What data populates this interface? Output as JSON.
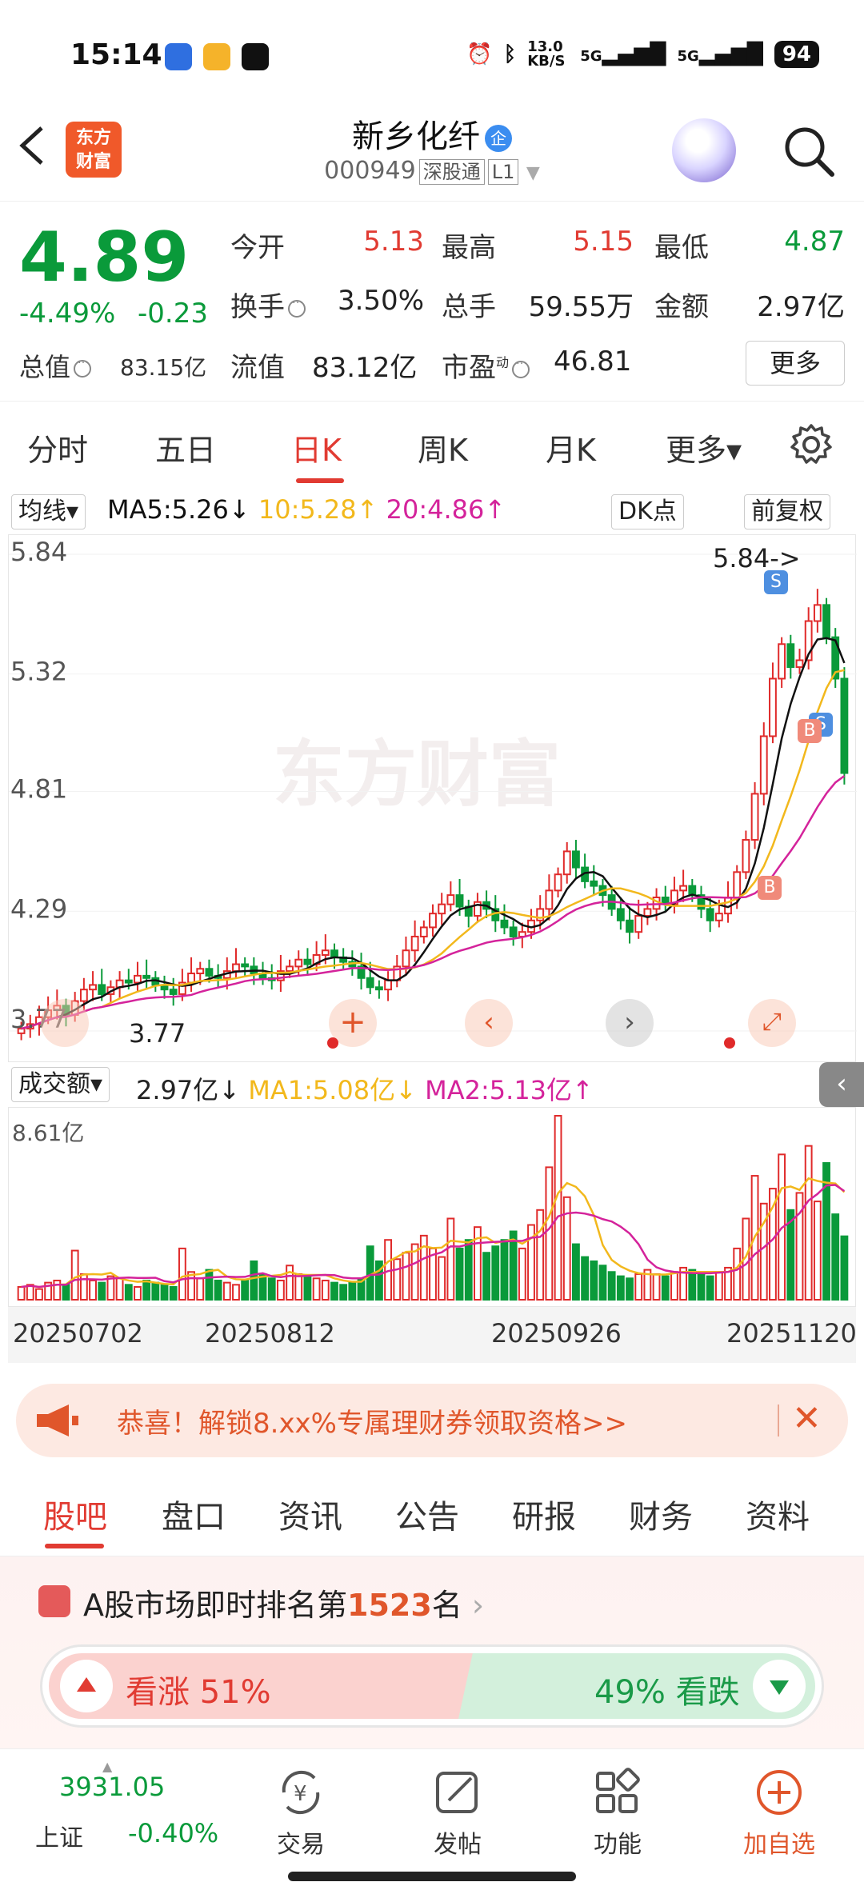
{
  "status_bar": {
    "time": "15:14",
    "net_speed": "13.0 KB/S",
    "network_1": "5G",
    "network_2": "5G",
    "battery": "94"
  },
  "header": {
    "stock_name": "新乡化纤",
    "badge": "企",
    "stock_code": "000949",
    "tag_connect": "深股通",
    "tag_level": "L1",
    "brand_logo": "东方财富"
  },
  "quote": {
    "price": "4.89",
    "pct_change": "-4.49%",
    "abs_change": "-0.23",
    "open_label": "今开",
    "open_value": "5.13",
    "high_label": "最高",
    "high_value": "5.15",
    "low_label": "最低",
    "low_value": "4.87",
    "turnover_label": "换手",
    "turnover_value": "3.50%",
    "volume_label": "总手",
    "volume_value": "59.55万",
    "amount_label": "金额",
    "amount_value": "2.97亿",
    "mktcap_label": "总值",
    "mktcap_value": "83.15亿",
    "float_label": "流值",
    "float_value": "83.12亿",
    "pe_label": "市盈",
    "pe_sup": "动",
    "pe_value": "46.81",
    "more_button": "更多"
  },
  "period_tabs": [
    {
      "label": "分时"
    },
    {
      "label": "五日"
    },
    {
      "label": "日K"
    },
    {
      "label": "周K"
    },
    {
      "label": "月K"
    },
    {
      "label": "更多▾"
    }
  ],
  "ma": {
    "selector": "均线▾",
    "ma5": "MA5:5.26↓",
    "ma10": "10:5.28↑",
    "ma20": "20:4.86↑",
    "dk_button": "DK点",
    "adjust_button": "前复权"
  },
  "kline": {
    "y_labels": [
      "5.84",
      "5.32",
      "4.81",
      "4.29",
      "3.77"
    ],
    "high_marker": "5.84->",
    "low_marker": "3.77",
    "watermark": "东方财富",
    "buy_marker": "B",
    "sell_marker": "S"
  },
  "volume": {
    "selector": "成交额▾",
    "value": "2.97亿↓",
    "ma1": "MA1:5.08亿↓",
    "ma2": "MA2:5.13亿↑",
    "max_label": "8.61亿"
  },
  "dates": [
    "20250702",
    "20250812",
    "20250926",
    "20251120"
  ],
  "promo": {
    "text": "恭喜！解锁8.xx%专属理财券领取资格>>"
  },
  "section_tabs": [
    "股吧",
    "盘口",
    "资讯",
    "公告",
    "研报",
    "财务",
    "资料"
  ],
  "ranking": {
    "prefix": "A股市场即时排名第",
    "number": "1523",
    "suffix": "名",
    "up_text": "看涨 51%",
    "down_text": "49% 看跌"
  },
  "bottom_bar": {
    "index_value": "3931.05",
    "index_name": "上证",
    "index_pct": "-0.40%",
    "nav": [
      "交易",
      "发帖",
      "功能",
      "加自选"
    ]
  },
  "colors": {
    "up": "#e13b32",
    "down": "#0a9a3a",
    "ma5": "#111111",
    "ma10": "#f2b81c",
    "ma20": "#d4239b",
    "brand": "#f0592a"
  },
  "chart_data": [
    {
      "type": "candlestick",
      "title": "日K",
      "x_labels": [
        "20250702",
        "20250812",
        "20250926",
        "20251120"
      ],
      "ylim": [
        3.77,
        5.84
      ],
      "y_ticks": [
        5.84,
        5.32,
        4.81,
        4.29,
        3.77
      ],
      "annotations": [
        {
          "text": "5.84->",
          "value": 5.84
        },
        {
          "text": "3.77",
          "value": 3.77
        }
      ],
      "close_series": [
        3.78,
        3.8,
        3.83,
        3.86,
        3.88,
        3.84,
        3.9,
        3.95,
        3.97,
        3.93,
        3.96,
        3.99,
        3.98,
        4.01,
        4.0,
        3.97,
        3.95,
        3.93,
        3.98,
        4.02,
        4.04,
        4.01,
        4.0,
        4.03,
        4.06,
        4.05,
        4.02,
        4.0,
        3.99,
        4.03,
        4.05,
        4.08,
        4.06,
        4.1,
        4.12,
        4.09,
        4.07,
        4.05,
        4.0,
        3.96,
        3.95,
        3.99,
        4.05,
        4.12,
        4.18,
        4.22,
        4.28,
        4.32,
        4.36,
        4.31,
        4.27,
        4.33,
        4.3,
        4.25,
        4.22,
        4.18,
        4.2,
        4.25,
        4.3,
        4.38,
        4.45,
        4.55,
        4.48,
        4.42,
        4.4,
        4.36,
        4.3,
        4.25,
        4.2,
        4.27,
        4.3,
        4.35,
        4.32,
        4.38,
        4.4,
        4.36,
        4.3,
        4.25,
        4.28,
        4.35,
        4.46,
        4.6,
        4.8,
        5.05,
        5.3,
        5.45,
        5.35,
        5.38,
        5.55,
        5.62,
        5.48,
        5.3,
        4.89
      ],
      "series": [
        {
          "name": "MA5",
          "value": 5.26
        },
        {
          "name": "MA10",
          "value": 5.28
        },
        {
          "name": "MA20",
          "value": 4.86
        }
      ]
    },
    {
      "type": "bar",
      "title": "成交额",
      "ylim": [
        0,
        8.61
      ],
      "unit": "亿",
      "values": [
        0.6,
        0.7,
        0.5,
        0.8,
        0.9,
        0.7,
        2.3,
        1.2,
        0.9,
        0.8,
        1.1,
        1.0,
        0.7,
        0.6,
        0.9,
        0.8,
        0.7,
        0.6,
        2.4,
        1.3,
        1.0,
        1.4,
        0.9,
        0.8,
        0.7,
        0.9,
        1.8,
        1.2,
        1.0,
        0.9,
        1.6,
        1.2,
        1.1,
        1.0,
        0.9,
        0.8,
        0.7,
        0.8,
        1.0,
        2.5,
        1.8,
        2.8,
        1.9,
        2.2,
        2.6,
        3.0,
        2.4,
        2.0,
        3.8,
        2.4,
        2.8,
        3.4,
        2.2,
        2.5,
        2.8,
        3.2,
        2.4,
        3.5,
        4.2,
        6.2,
        8.61,
        4.8,
        2.6,
        2.0,
        1.8,
        1.6,
        1.3,
        1.1,
        1.0,
        1.2,
        1.4,
        1.2,
        1.1,
        1.3,
        1.5,
        1.4,
        1.2,
        1.1,
        1.3,
        1.5,
        2.4,
        3.8,
        5.8,
        4.5,
        5.2,
        6.8,
        4.2,
        5.0,
        7.2,
        4.6,
        6.4,
        4.0,
        2.97
      ],
      "series": [
        {
          "name": "MA1",
          "value": 5.08
        },
        {
          "name": "MA2",
          "value": 5.13
        }
      ]
    }
  ]
}
